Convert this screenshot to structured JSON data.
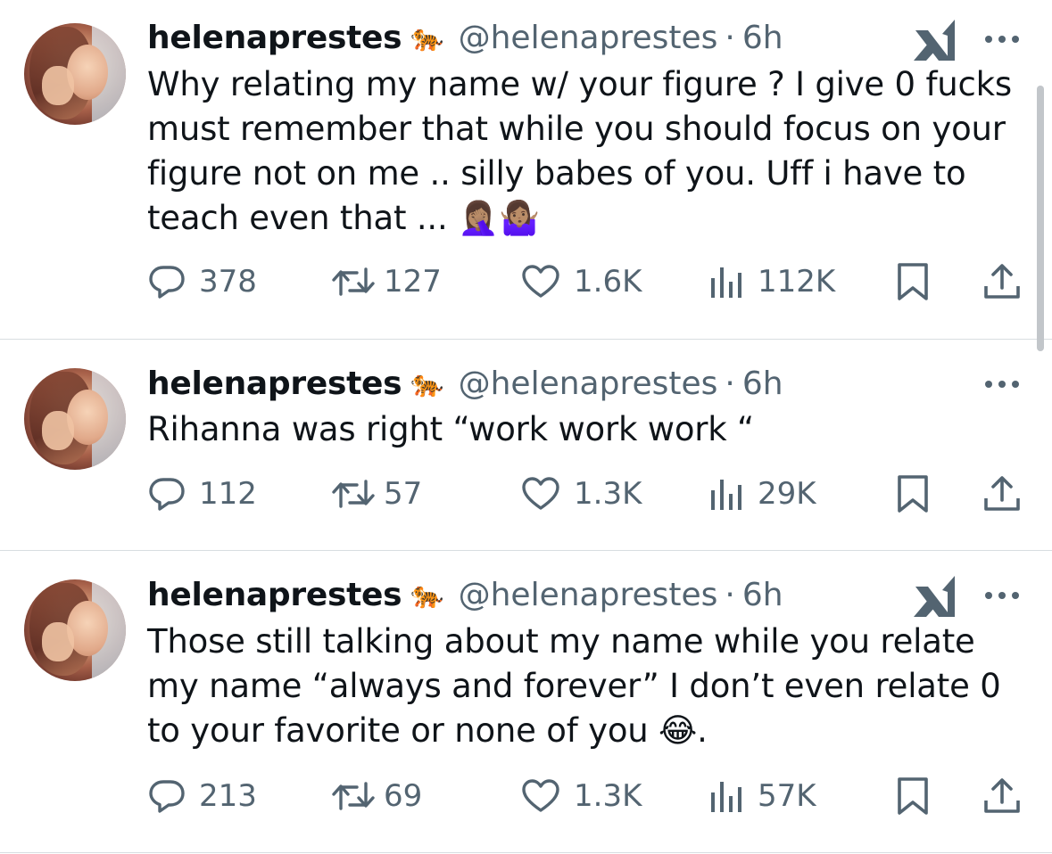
{
  "tweets": [
    {
      "display_name": "helenaprestes",
      "emoji": "🐅",
      "handle": "@helenaprestes",
      "separator": "·",
      "time": "6h",
      "show_x_logo": true,
      "text": "Why relating my name w/ your figure ? I give 0 fucks must remember that while you should focus on your figure not on me .. silly babes of you. Uff i have to teach even that ... 🤦🏽‍♀️🤷🏽‍♀️",
      "replies": "378",
      "reposts": "127",
      "likes": "1.6K",
      "views": "112K"
    },
    {
      "display_name": "helenaprestes",
      "emoji": "🐅",
      "handle": "@helenaprestes",
      "separator": "·",
      "time": "6h",
      "show_x_logo": false,
      "text": "Rihanna was right “work work work “",
      "replies": "112",
      "reposts": "57",
      "likes": "1.3K",
      "views": "29K"
    },
    {
      "display_name": "helenaprestes",
      "emoji": "🐅",
      "handle": "@helenaprestes",
      "separator": "·",
      "time": "6h",
      "show_x_logo": true,
      "text": "Those still talking about my name while you relate my name “always and forever” I don’t even relate 0 to your favorite or none of you 😂.",
      "replies": "213",
      "reposts": "69",
      "likes": "1.3K",
      "views": "57K"
    }
  ],
  "colors": {
    "text": "#0f1419",
    "secondary": "#536471",
    "divider": "#d8dde1",
    "scrollbar": "#c2c6ca"
  },
  "icons": {
    "reply": "speech-bubble-icon",
    "repost": "repost-arrows-icon",
    "like": "heart-icon",
    "views": "bar-chart-icon",
    "bookmark": "bookmark-icon",
    "share": "share-upload-icon",
    "more": "more-dots-icon",
    "grok": "x-grok-logo-icon"
  }
}
